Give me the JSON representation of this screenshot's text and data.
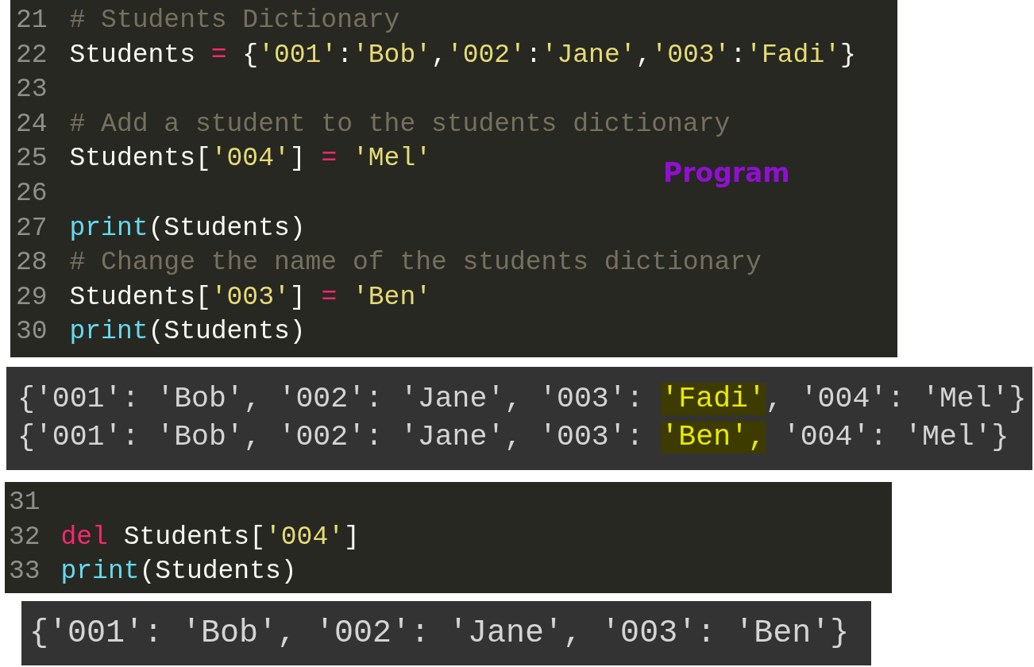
{
  "code_panels": [
    {
      "lines": [
        {
          "number": "21",
          "tokens": [
            {
              "kind": "comment",
              "text": "# Students Dictionary"
            }
          ]
        },
        {
          "number": "22",
          "tokens": [
            {
              "kind": "plain",
              "text": "Students "
            },
            {
              "kind": "operator",
              "text": "="
            },
            {
              "kind": "plain",
              "text": " {"
            },
            {
              "kind": "string",
              "text": "'001'"
            },
            {
              "kind": "plain",
              "text": ":"
            },
            {
              "kind": "string",
              "text": "'Bob'"
            },
            {
              "kind": "plain",
              "text": ","
            },
            {
              "kind": "string",
              "text": "'002'"
            },
            {
              "kind": "plain",
              "text": ":"
            },
            {
              "kind": "string",
              "text": "'Jane'"
            },
            {
              "kind": "plain",
              "text": ","
            },
            {
              "kind": "string",
              "text": "'003'"
            },
            {
              "kind": "plain",
              "text": ":"
            },
            {
              "kind": "string",
              "text": "'Fadi'"
            },
            {
              "kind": "plain",
              "text": "}"
            }
          ]
        },
        {
          "number": "23"
        },
        {
          "number": "24",
          "tokens": [
            {
              "kind": "comment",
              "text": "# Add a student to the students dictionary"
            }
          ]
        },
        {
          "number": "25",
          "tokens": [
            {
              "kind": "plain",
              "text": "Students["
            },
            {
              "kind": "string",
              "text": "'004'"
            },
            {
              "kind": "plain",
              "text": "] "
            },
            {
              "kind": "operator",
              "text": "="
            },
            {
              "kind": "string",
              "text": " 'Mel'"
            }
          ]
        },
        {
          "number": "26"
        },
        {
          "number": "27",
          "tokens": [
            {
              "kind": "builtin",
              "text": "print"
            },
            {
              "kind": "plain",
              "text": "(Students)"
            }
          ]
        },
        {
          "number": "28",
          "tokens": [
            {
              "kind": "comment",
              "text": "# Change the name of the students dictionary"
            }
          ]
        },
        {
          "number": "29",
          "tokens": [
            {
              "kind": "plain",
              "text": "Students["
            },
            {
              "kind": "string",
              "text": "'003'"
            },
            {
              "kind": "plain",
              "text": "] "
            },
            {
              "kind": "operator",
              "text": "="
            },
            {
              "kind": "string",
              "text": " 'Ben'"
            }
          ]
        },
        {
          "number": "30",
          "tokens": [
            {
              "kind": "builtin",
              "text": "print"
            },
            {
              "kind": "plain",
              "text": "(Students)"
            }
          ]
        }
      ],
      "label": "Program"
    },
    {
      "lines": [
        {
          "number": "31"
        },
        {
          "number": "32",
          "tokens": [
            {
              "kind": "keyword",
              "text": "del"
            },
            {
              "kind": "plain",
              "text": " Students["
            },
            {
              "kind": "string",
              "text": "'004'"
            },
            {
              "kind": "plain",
              "text": "]"
            }
          ]
        },
        {
          "number": "33",
          "tokens": [
            {
              "kind": "builtin",
              "text": "print"
            },
            {
              "kind": "plain",
              "text": "(Students)"
            }
          ]
        }
      ]
    }
  ],
  "output_panels": [
    {
      "lines": [
        [
          {
            "text": "{'001': 'Bob', '002': 'Jane', '003': ",
            "highlighted": false
          },
          {
            "text": "'Fadi'",
            "highlighted": true
          },
          {
            "text": ", '004': 'Mel'}",
            "highlighted": false
          }
        ],
        [
          {
            "text": "{'001': 'Bob', '002': 'Jane', '003': ",
            "highlighted": false
          },
          {
            "text": "'Ben',",
            "highlighted": true
          },
          {
            "text": " '004': 'Mel'}",
            "highlighted": false
          }
        ]
      ]
    },
    {
      "lines": [
        [
          {
            "text": "{'001': 'Bob', '002': 'Jane', '003': 'Ben'}",
            "highlighted": false
          }
        ]
      ]
    }
  ]
}
